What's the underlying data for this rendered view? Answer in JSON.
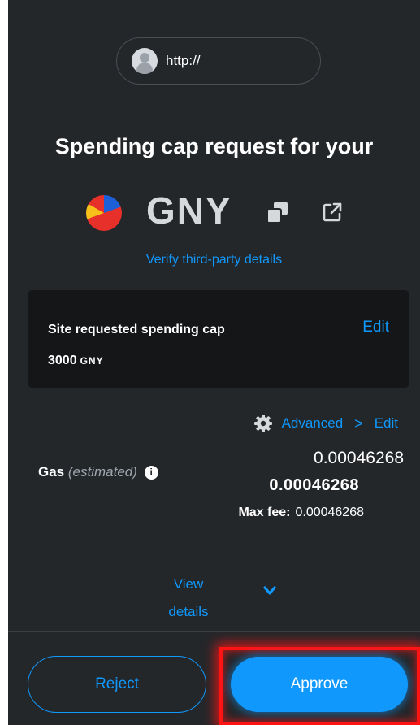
{
  "origin": {
    "url": "http://"
  },
  "title": "Spending cap request for your",
  "token": {
    "symbol": "GNY"
  },
  "verify_link": "Verify third-party details",
  "spending_cap": {
    "label": "Site requested spending cap",
    "edit_label": "Edit",
    "amount": "3000",
    "unit": "GNY"
  },
  "gas": {
    "advanced_label": "Advanced",
    "chevron": ">",
    "edit_label": "Edit",
    "label": "Gas",
    "estimated": "(estimated)",
    "info_glyph": "i",
    "fiat_value": "0.00046268",
    "native_value": "0.00046268",
    "max_fee_label": "Max fee:",
    "max_fee_value": "0.00046268"
  },
  "view_details": {
    "line1": "View",
    "line2": "details"
  },
  "buttons": {
    "reject": "Reject",
    "approve": "Approve"
  },
  "colors": {
    "accent": "#1098fc",
    "background": "#24272a",
    "highlight": "#ff1414"
  }
}
